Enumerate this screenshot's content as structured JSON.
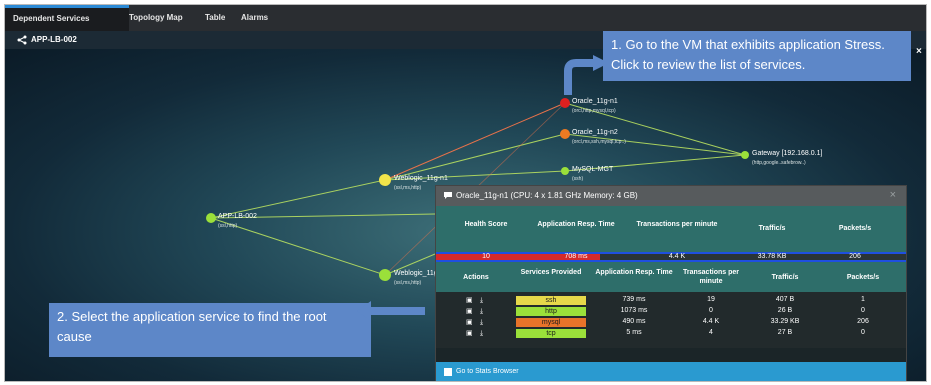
{
  "tabs": [
    "Dependent Services",
    "Topology Map",
    "Table",
    "Alarms"
  ],
  "subtitle": "APP-LB-002",
  "callouts": {
    "step1": "1. Go to the VM that exhibits application Stress. Click to review the list of services.",
    "step2": "2. Select the application service to find the root cause"
  },
  "close_glyph": "×",
  "nodes": [
    {
      "label": "Oracle_11g-n1",
      "sub": "(orcl,http,mysql,tcp)",
      "color": "#e02020"
    },
    {
      "label": "Oracle_11g-n2",
      "sub": "(orcl,ms,ssh,mysql,tcp..)",
      "color": "#ee7a22"
    },
    {
      "label": "MySQL-MGT",
      "sub": "(ssh)",
      "color": "#9be03a"
    },
    {
      "label": "Gateway [192.168.0.1]",
      "sub": "(http,google..safebrow..)",
      "color": "#9be03a"
    },
    {
      "label": "Weblogic_11g-n1",
      "sub": "(ssl,ms,http)",
      "color": "#f2e44a"
    },
    {
      "label": "APP-LB-002",
      "sub": "(ssl,http)",
      "color": "#9be03a"
    },
    {
      "label": "Weblogic_11g-n2",
      "sub": "(ssl,ms,http)",
      "color": "#9be03a"
    }
  ],
  "panel": {
    "title": "Oracle_11g-n1 (CPU: 4 x 1.81 GHz Memory: 4 GB)",
    "close": "×",
    "summary_headers": [
      "Health Score",
      "Application Resp. Time",
      "Transactions per minute",
      "Traffic/s",
      "Packets/s"
    ],
    "summary_values": [
      "10",
      "708 ms",
      "4.4 K",
      "33.78 KB",
      "206"
    ],
    "service_headers": [
      "Actions",
      "Services Provided",
      "Application Resp. Time",
      "Transactions per minute",
      "Traffic/s",
      "Packets/s"
    ],
    "rows": [
      {
        "service": "ssh",
        "color": "#e6d84a",
        "resp": "739 ms",
        "tpm": "19",
        "traffic": "407 B",
        "packets": "1"
      },
      {
        "service": "http",
        "color": "#9be03a",
        "resp": "1073 ms",
        "tpm": "0",
        "traffic": "26 B",
        "packets": "0"
      },
      {
        "service": "mysql",
        "color": "#e8732a",
        "resp": "490 ms",
        "tpm": "4.4 K",
        "traffic": "33.29 KB",
        "packets": "206"
      },
      {
        "service": "tcp",
        "color": "#9be03a",
        "resp": "5 ms",
        "tpm": "4",
        "traffic": "27 B",
        "packets": "0"
      }
    ],
    "footer": "Go to Stats Browser"
  },
  "colors": {
    "accent_blue": "#2b8ad6",
    "callout": "#5d87c8",
    "critical": "#e02020",
    "warning": "#ee7a22"
  },
  "icons": [
    "share-icon",
    "chat-icon",
    "camera-icon",
    "download-icon",
    "stats-icon",
    "arrow-up-right-icon",
    "arrow-left-icon"
  ]
}
